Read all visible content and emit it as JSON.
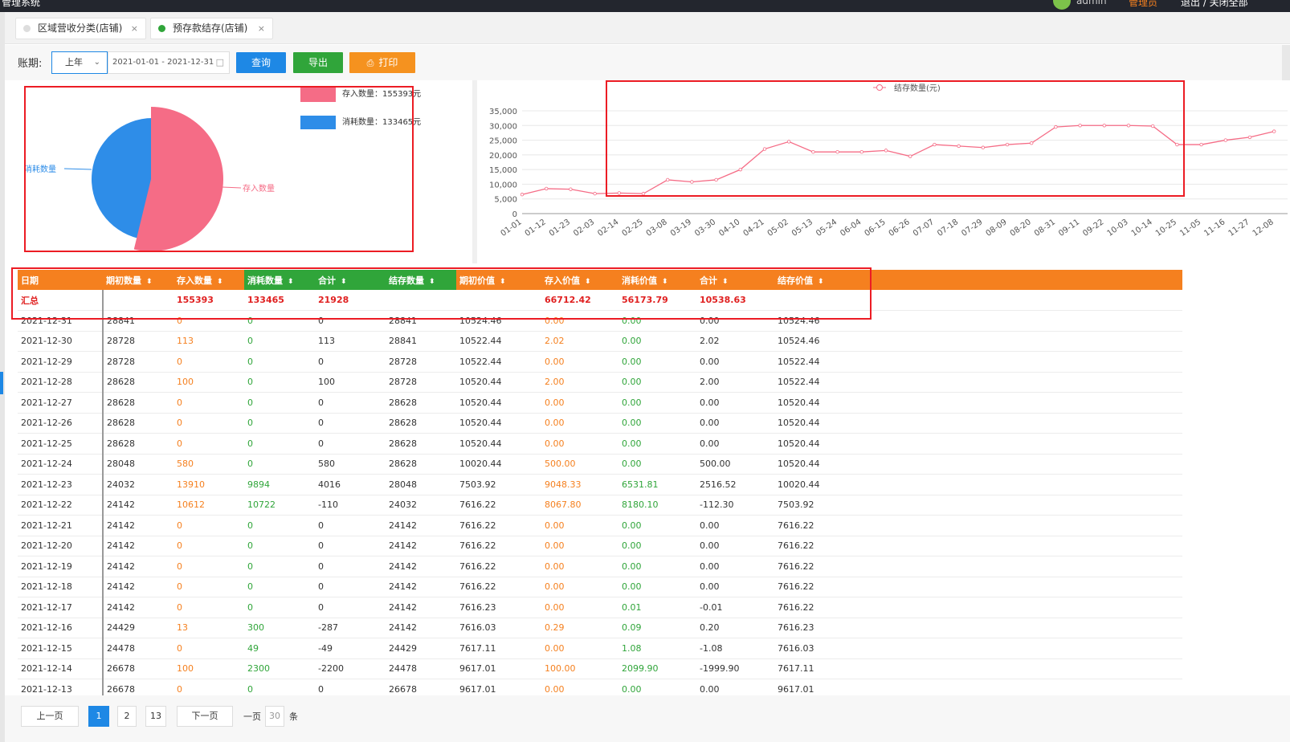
{
  "topbar": {
    "left_text": "管理系统",
    "user": "admin",
    "right1": "管理员",
    "right2": "退出 / 关闭全部"
  },
  "tabs": [
    {
      "label": "区域营收分类(店铺)",
      "close": "×",
      "dot": "#dddddd"
    },
    {
      "label": "预存款结存(店铺)",
      "close": "×",
      "dot": "#30a53a"
    }
  ],
  "filter": {
    "label": "账期:",
    "period": "上年",
    "date_range": "2021-01-01 - 2021-12-31",
    "query": "查询",
    "export": "导出",
    "print": "打印"
  },
  "colors": {
    "orange": "#f5801f",
    "green": "#30a53a",
    "blue": "#1e88e5",
    "pink": "#f56c86",
    "red": "#ec1c24"
  },
  "pie": {
    "legend": [
      {
        "name": "存入数量",
        "value_text": "存入数量：155393元",
        "color": "#f56c86"
      },
      {
        "name": "消耗数量",
        "value_text": "消耗数量：133465元",
        "color": "#2e8de8"
      }
    ],
    "label_in": "存入数量",
    "label_out": "消耗数量"
  },
  "chart_data": {
    "type": "line",
    "legend": "结存数量(元)",
    "color": "#f56c86",
    "ylim": [
      0,
      35000
    ],
    "yticks": [
      0,
      5000,
      10000,
      15000,
      20000,
      25000,
      30000,
      35000
    ],
    "ytick_labels": [
      "0",
      "5,000",
      "10,000",
      "15,000",
      "20,000",
      "25,000",
      "30,000",
      "35,000"
    ],
    "x": [
      "01-01",
      "01-12",
      "01-23",
      "02-03",
      "02-14",
      "02-25",
      "03-08",
      "03-19",
      "03-30",
      "04-10",
      "04-21",
      "05-02",
      "05-13",
      "05-24",
      "06-04",
      "06-15",
      "06-26",
      "07-07",
      "07-18",
      "07-29",
      "08-09",
      "08-20",
      "08-31",
      "09-11",
      "09-22",
      "10-03",
      "10-14",
      "10-25",
      "11-05",
      "11-16",
      "11-27",
      "12-08"
    ],
    "values": [
      6500,
      8500,
      8300,
      6800,
      7000,
      6800,
      11500,
      10800,
      11500,
      15000,
      22000,
      24500,
      21000,
      21000,
      21000,
      21500,
      19500,
      23500,
      23000,
      22500,
      23500,
      24000,
      29500,
      30000,
      30000,
      30000,
      29800,
      23500,
      23500,
      25000,
      26000,
      28000
    ],
    "ylabel": "",
    "xlabel": ""
  },
  "table": {
    "headers": [
      "日期",
      "期初数量",
      "存入数量",
      "消耗数量",
      "合计",
      "结存数量",
      "期初价值",
      "存入价值",
      "消耗价值",
      "合计",
      "结存价值"
    ],
    "summary": [
      "汇总",
      "",
      "155393",
      "133465",
      "21928",
      "",
      "",
      "66712.42",
      "56173.79",
      "10538.63",
      ""
    ],
    "rows": [
      [
        "2021-12-31",
        "28841",
        "0",
        "0",
        "0",
        "28841",
        "10524.46",
        "0.00",
        "0.00",
        "0.00",
        "10524.46"
      ],
      [
        "2021-12-30",
        "28728",
        "113",
        "0",
        "113",
        "28841",
        "10522.44",
        "2.02",
        "0.00",
        "2.02",
        "10524.46"
      ],
      [
        "2021-12-29",
        "28728",
        "0",
        "0",
        "0",
        "28728",
        "10522.44",
        "0.00",
        "0.00",
        "0.00",
        "10522.44"
      ],
      [
        "2021-12-28",
        "28628",
        "100",
        "0",
        "100",
        "28728",
        "10520.44",
        "2.00",
        "0.00",
        "2.00",
        "10522.44"
      ],
      [
        "2021-12-27",
        "28628",
        "0",
        "0",
        "0",
        "28628",
        "10520.44",
        "0.00",
        "0.00",
        "0.00",
        "10520.44"
      ],
      [
        "2021-12-26",
        "28628",
        "0",
        "0",
        "0",
        "28628",
        "10520.44",
        "0.00",
        "0.00",
        "0.00",
        "10520.44"
      ],
      [
        "2021-12-25",
        "28628",
        "0",
        "0",
        "0",
        "28628",
        "10520.44",
        "0.00",
        "0.00",
        "0.00",
        "10520.44"
      ],
      [
        "2021-12-24",
        "28048",
        "580",
        "0",
        "580",
        "28628",
        "10020.44",
        "500.00",
        "0.00",
        "500.00",
        "10520.44"
      ],
      [
        "2021-12-23",
        "24032",
        "13910",
        "9894",
        "4016",
        "28048",
        "7503.92",
        "9048.33",
        "6531.81",
        "2516.52",
        "10020.44"
      ],
      [
        "2021-12-22",
        "24142",
        "10612",
        "10722",
        "-110",
        "24032",
        "7616.22",
        "8067.80",
        "8180.10",
        "-112.30",
        "7503.92"
      ],
      [
        "2021-12-21",
        "24142",
        "0",
        "0",
        "0",
        "24142",
        "7616.22",
        "0.00",
        "0.00",
        "0.00",
        "7616.22"
      ],
      [
        "2021-12-20",
        "24142",
        "0",
        "0",
        "0",
        "24142",
        "7616.22",
        "0.00",
        "0.00",
        "0.00",
        "7616.22"
      ],
      [
        "2021-12-19",
        "24142",
        "0",
        "0",
        "0",
        "24142",
        "7616.22",
        "0.00",
        "0.00",
        "0.00",
        "7616.22"
      ],
      [
        "2021-12-18",
        "24142",
        "0",
        "0",
        "0",
        "24142",
        "7616.22",
        "0.00",
        "0.00",
        "0.00",
        "7616.22"
      ],
      [
        "2021-12-17",
        "24142",
        "0",
        "0",
        "0",
        "24142",
        "7616.23",
        "0.00",
        "0.01",
        "-0.01",
        "7616.22"
      ],
      [
        "2021-12-16",
        "24429",
        "13",
        "300",
        "-287",
        "24142",
        "7616.03",
        "0.29",
        "0.09",
        "0.20",
        "7616.23"
      ],
      [
        "2021-12-15",
        "24478",
        "0",
        "49",
        "-49",
        "24429",
        "7617.11",
        "0.00",
        "1.08",
        "-1.08",
        "7616.03"
      ],
      [
        "2021-12-14",
        "26678",
        "100",
        "2300",
        "-2200",
        "24478",
        "9617.01",
        "100.00",
        "2099.90",
        "-1999.90",
        "7617.11"
      ],
      [
        "2021-12-13",
        "26678",
        "0",
        "0",
        "0",
        "26678",
        "9617.01",
        "0.00",
        "0.00",
        "0.00",
        "9617.01"
      ]
    ]
  },
  "pager": {
    "prev": "上一页",
    "pages": [
      "1",
      "2",
      "13"
    ],
    "next": "下一页",
    "goto": "一页",
    "size": "30",
    "unit": "条"
  }
}
